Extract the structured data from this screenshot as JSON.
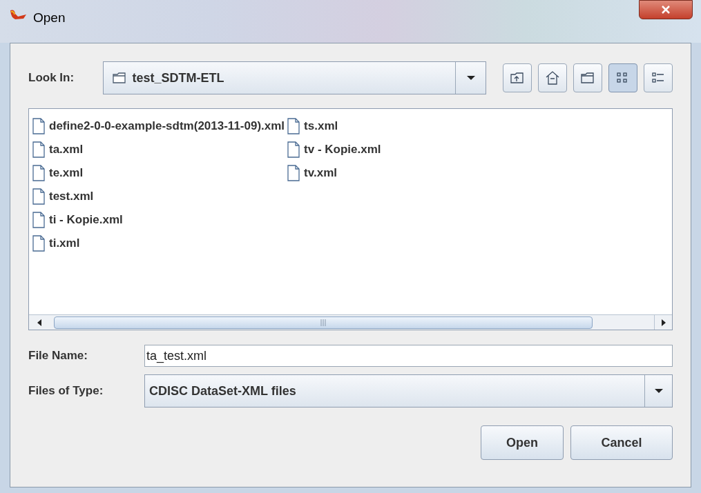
{
  "window": {
    "title": "Open"
  },
  "look_in": {
    "label": "Look In:",
    "value": "test_SDTM-ETL"
  },
  "toolbar": [
    {
      "kind": "up",
      "selected": false
    },
    {
      "kind": "home",
      "selected": false
    },
    {
      "kind": "new-folder",
      "selected": false
    },
    {
      "kind": "list",
      "selected": true
    },
    {
      "kind": "details",
      "selected": false
    }
  ],
  "files": [
    {
      "name": "define2-0-0-example-sdtm(2013-11-09).xml"
    },
    {
      "name": "ta.xml"
    },
    {
      "name": "te.xml"
    },
    {
      "name": "test.xml"
    },
    {
      "name": "ti - Kopie.xml"
    },
    {
      "name": "ti.xml"
    },
    {
      "name": "ts.xml"
    },
    {
      "name": "tv - Kopie.xml"
    },
    {
      "name": "tv.xml"
    }
  ],
  "file_name": {
    "label": "File Name:",
    "value": "ta_test.xml"
  },
  "file_type": {
    "label": "Files of Type:",
    "value": "CDISC DataSet-XML files"
  },
  "buttons": [
    {
      "label": "Open"
    },
    {
      "label": "Cancel"
    }
  ]
}
